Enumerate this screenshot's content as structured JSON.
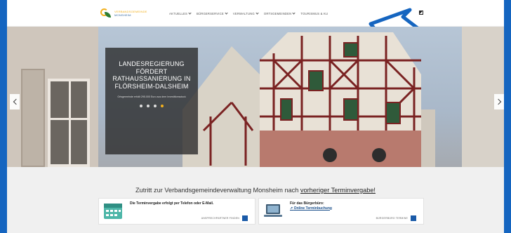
{
  "header": {
    "logo_line1": "VERBANDSGEMEINDE",
    "logo_line2": "MONSHEIM",
    "nav": [
      {
        "label": "AKTUELLES"
      },
      {
        "label": "BÜRGERSERVICE"
      },
      {
        "label": "VERWALTUNG"
      },
      {
        "label": "ORTSGEMEINDEN"
      },
      {
        "label": "TOURISMUS & KU"
      }
    ],
    "icons": {
      "contrast": "contrast-icon",
      "arrow": "pointer-arrow-icon"
    }
  },
  "slider": {
    "title": "LANDESREGIERUNG FÖRDERT RATHAUSSANIERUNG IN FLÖRSHEIM-DALSHEIM",
    "subtitle": "Ortsgemeinde erhält 295.000 Euro aus dem Investitionsstock",
    "dot_count": 4,
    "active_dot": 4,
    "prev_icon": "chevron-left-icon",
    "next_icon": "chevron-right-icon"
  },
  "notice": {
    "text_before": "Zutritt zur Verbandsgemeindeverwaltung Monsheim nach ",
    "link": "vorheriger Terminvergabe!"
  },
  "cards": [
    {
      "icon": "calendar-icon",
      "title": "Die Terminvergabe erfolgt per Telefon oder E-Mail.",
      "button": "ANSPRECHPARTNER FINDEN"
    },
    {
      "icon": "laptop-icon",
      "title": "Für das Bürgerbüro:",
      "link": "Online Terminbuchung",
      "button": "BÜRGERBÜRO TERMINE"
    }
  ],
  "colors": {
    "accent": "#1a5aa8",
    "gold": "#f2b01e",
    "frame": "#1565c0"
  }
}
